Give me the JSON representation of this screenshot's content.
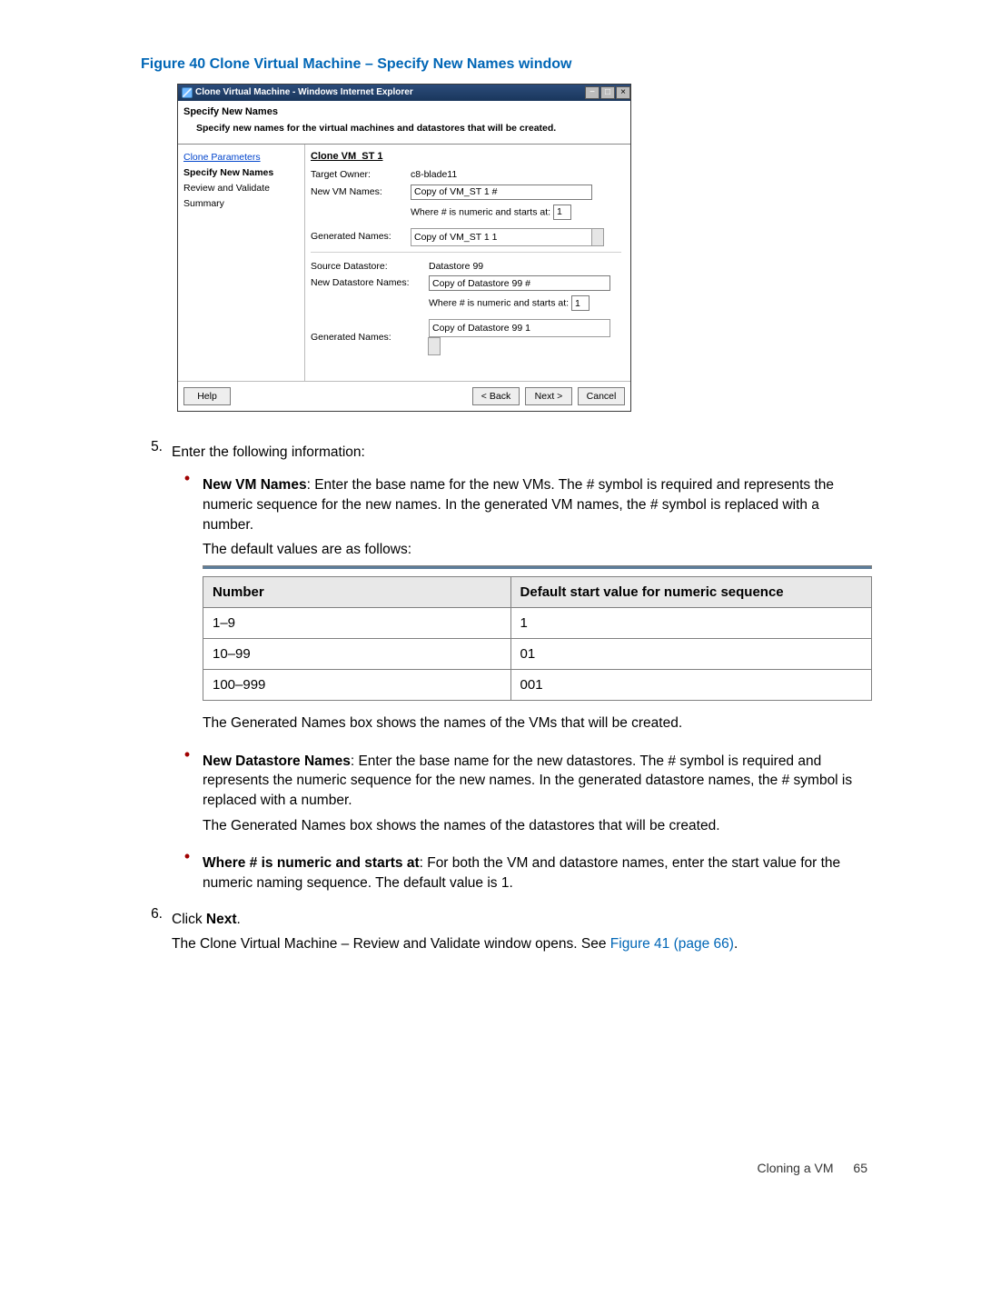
{
  "figure": {
    "caption": "Figure 40 Clone Virtual Machine – Specify New Names window"
  },
  "dialog": {
    "titlebar": "Clone Virtual Machine - Windows Internet Explorer",
    "header_title": "Specify New Names",
    "header_sub": "Specify new names for the virtual machines and datastores that will be created.",
    "steps": {
      "s1": "Clone Parameters",
      "s2": "Specify New Names",
      "s3": "Review and Validate",
      "s4": "Summary"
    },
    "group_title": "Clone VM_ST 1",
    "labels": {
      "target_owner": "Target Owner:",
      "new_vm_names": "New VM Names:",
      "generated_names": "Generated Names:",
      "source_datastore": "Source Datastore:",
      "new_datastore_names": "New Datastore Names:",
      "where_prefix": "Where # is numeric and starts at:"
    },
    "values": {
      "target_owner": "c8-blade11",
      "new_vm_names": "Copy of VM_ST 1 #",
      "vm_where_num": "1",
      "vm_generated": "Copy of VM_ST 1 1",
      "source_datastore": "Datastore 99",
      "new_datastore_names": "Copy of Datastore 99 #",
      "ds_where_num": "1",
      "ds_generated": "Copy of Datastore 99 1"
    },
    "buttons": {
      "help": "Help",
      "back": "< Back",
      "next": "Next >",
      "cancel": "Cancel"
    }
  },
  "body": {
    "step5_num": "5.",
    "step5_text": "Enter the following information:",
    "b1_label": "New VM Names",
    "b1_text": ": Enter the base name for the new VMs. The # symbol is required and represents the numeric sequence for the new names. In the generated VM names, the # symbol is replaced with a number.",
    "b1_follow": "The default values are as follows:",
    "table": {
      "h1": "Number",
      "h2": "Default start value for numeric sequence",
      "rows": [
        {
          "c1": "1–9",
          "c2": "1"
        },
        {
          "c1": "10–99",
          "c2": "01"
        },
        {
          "c1": "100–999",
          "c2": "001"
        }
      ]
    },
    "b1_after": "The Generated Names box shows the names of the VMs that will be created.",
    "b2_label": "New Datastore Names",
    "b2_text": ": Enter the base name for the new datastores. The # symbol is required and represents the numeric sequence for the new names. In the generated datastore names, the # symbol is replaced with a number.",
    "b2_after": "The Generated Names box shows the names of the datastores that will be created.",
    "b3_label": "Where # is numeric and starts at",
    "b3_text": ": For both the VM and datastore names, enter the start value for the numeric naming sequence. The default value is 1.",
    "step6_num": "6.",
    "step6_text_pre": "Click ",
    "step6_bold": "Next",
    "step6_text_post": ".",
    "step6_follow_pre": "The Clone Virtual Machine – Review and Validate window opens. See ",
    "step6_link": "Figure 41 (page 66)",
    "step6_follow_post": "."
  },
  "footer": {
    "section": "Cloning a VM",
    "page": "65"
  }
}
